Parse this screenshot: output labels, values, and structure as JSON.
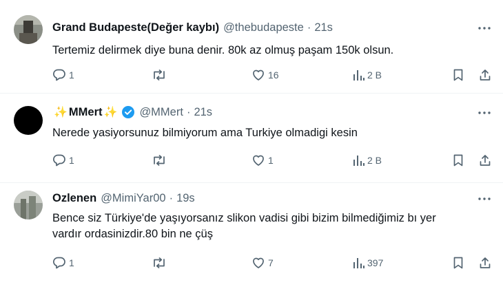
{
  "tweets": [
    {
      "name": "Grand Budapeste(Değer kaybı)",
      "handle": "@thebudapeste",
      "time": "21s",
      "text": "Tertemiz delirmek diye buna denir. 80k az olmuş paşam 150k olsun.",
      "replies": "1",
      "retweets": "",
      "likes": "16",
      "views": "2 B"
    },
    {
      "name": "MMert",
      "name_decor": "✨",
      "handle": "@MMert",
      "time": "21s",
      "text": "Nerede yasiyorsunuz bilmiyorum ama Turkiye olmadigi kesin",
      "replies": "1",
      "retweets": "",
      "likes": "1",
      "views": "2 B"
    },
    {
      "name": "Ozlenen",
      "handle": "@MimiYar00",
      "time": "19s",
      "text_line1": "Bence siz Türkiye'de yaşıyorsanız slikon vadisi gibi bizim bilmediğimiz bı yer",
      "text_line2": "vardır ordasinizdir.80 bin ne çüş",
      "replies": "1",
      "retweets": "",
      "likes": "7",
      "views": "397"
    }
  ],
  "separator": "·",
  "colors": {
    "text": "#0f1419",
    "secondary": "#536471",
    "verified": "#1d9bf0",
    "border": "#eff3f4"
  },
  "icons": [
    "more-icon",
    "reply-icon",
    "retweet-icon",
    "like-icon",
    "views-icon",
    "bookmark-icon",
    "share-icon",
    "verified-icon"
  ]
}
